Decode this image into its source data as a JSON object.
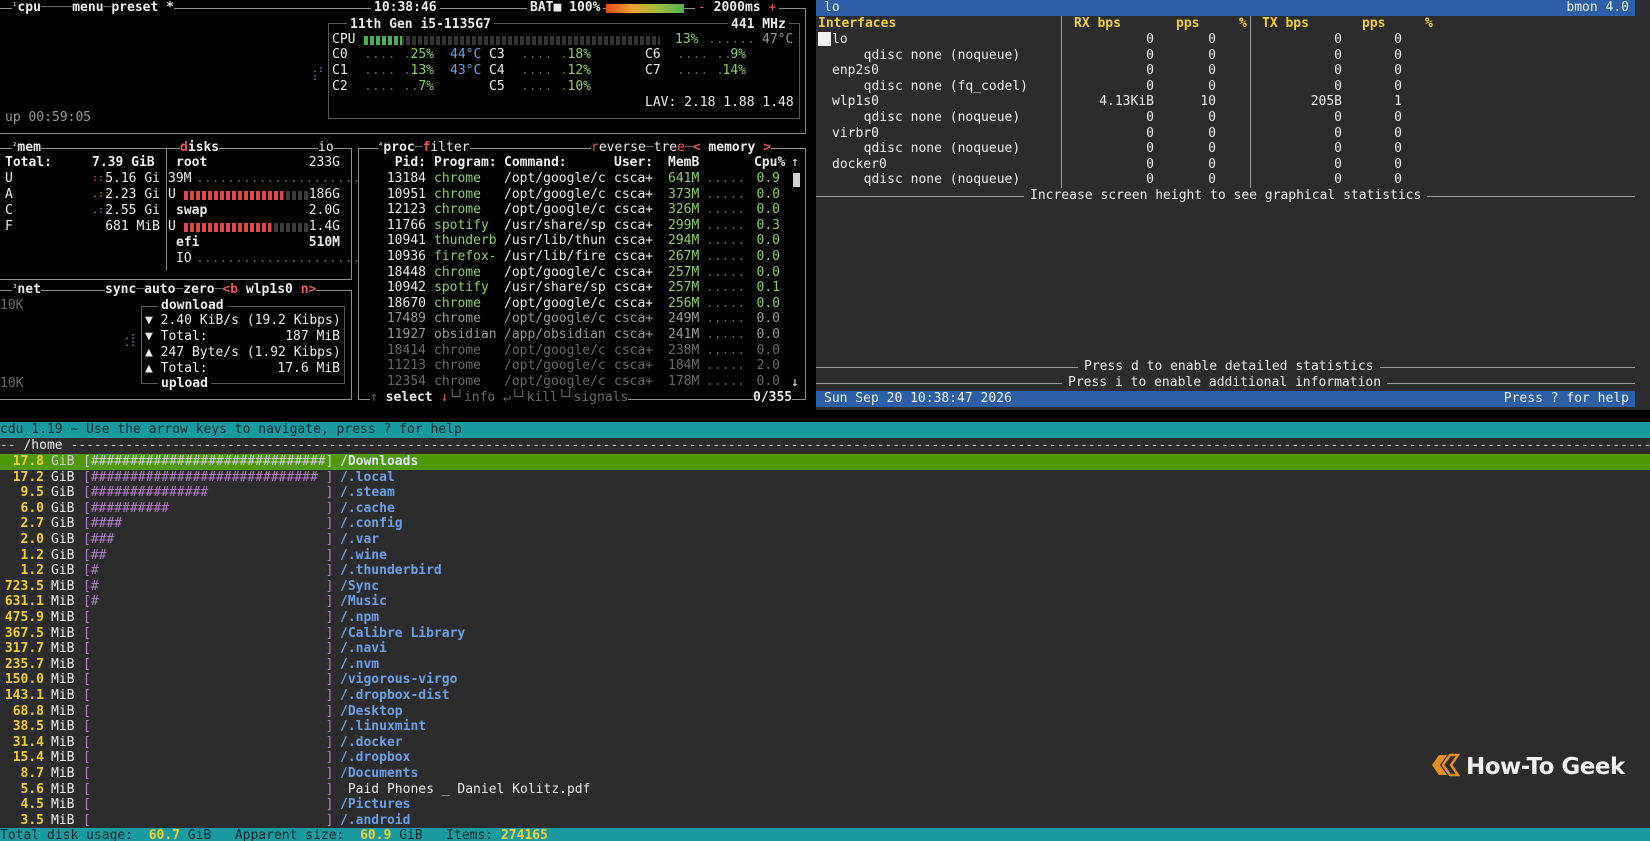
{
  "btop": {
    "cpu_box": {
      "tab_cpu": "cpu",
      "tab_menu": "menu",
      "tab_preset": "preset *",
      "clock": "10:38:46",
      "battery_label": "BAT",
      "battery_pct": "100%",
      "battery_level": 1.0,
      "update_ms": "2000ms",
      "cpu_name": "11th Gen i5-1135G7",
      "cpu_freq": "441 MHz",
      "cpu_total_label": "CPU",
      "cpu_total_pct": "13%",
      "cpu_total_temp": "47°C",
      "cpu_total_level": 0.13,
      "cores": [
        {
          "name": "C0",
          "pct": "25%",
          "temp": "44°C"
        },
        {
          "name": "C1",
          "pct": "13%",
          "temp": "43°C"
        },
        {
          "name": "C2",
          "pct": "7%",
          "temp": ""
        },
        {
          "name": "C3",
          "pct": "18%",
          "temp": ""
        },
        {
          "name": "C4",
          "pct": "12%",
          "temp": ""
        },
        {
          "name": "C5",
          "pct": "10%",
          "temp": ""
        },
        {
          "name": "C6",
          "pct": "9%",
          "temp": ""
        },
        {
          "name": "C7",
          "pct": "14%",
          "temp": ""
        }
      ],
      "load_avg": "LAV: 2.18 1.88 1.48",
      "uptime": "up 00:59:05"
    },
    "mem_box": {
      "title": "mem",
      "total_label": "Total:",
      "total": "7.39 GiB",
      "rows": [
        {
          "label": "U",
          "value": "5.16 Gi"
        },
        {
          "label": "A",
          "value": "2.23 Gi"
        },
        {
          "label": "C",
          "value": "2.55 Gi"
        },
        {
          "label": "F",
          "value": "681 MiB"
        }
      ]
    },
    "disks_box": {
      "title": "disks",
      "io_label": "io",
      "root_label": "root",
      "root_size": "233G",
      "root_io": "39M",
      "root_used_label": "U",
      "root_used": "186G",
      "root_used_level": 0.8,
      "swap_label": "swap",
      "swap_size": "2.0G",
      "swap_used_label": "U",
      "swap_used": "1.4G",
      "swap_used_level": 0.7,
      "efi_label": "efi",
      "efi_size": "510M",
      "efi_io_label": "IO"
    },
    "net_box": {
      "title": "net",
      "sync": "sync",
      "auto": "auto",
      "zero": "zero",
      "b_key": "<b",
      "iface": "wlp1s0",
      "n_key": "n>",
      "scale_top": "10K",
      "scale_bottom": "10K",
      "download_label": "download",
      "dl_rate": "▼ 2.40 KiB/s (19.2 Kibps)",
      "dl_total_label": "▼ Total:",
      "dl_total": "187 MiB",
      "ul_rate": "▲ 247 Byte/s (1.92 Kibps)",
      "ul_total_label": "▲ Total:",
      "ul_total": "17.6 MiB",
      "upload_label": "upload"
    },
    "proc_box": {
      "title": "proc",
      "filter": "filter",
      "reverse": "reverse",
      "tree": "tree",
      "sort_left": "<",
      "sort": "memory",
      "sort_right": ">",
      "headers": {
        "pid": "Pid:",
        "program": "Program:",
        "command": "Command:",
        "user": "User:",
        "mem": "MemB",
        "cpu": "Cpu%"
      },
      "rows": [
        {
          "pid": "13184",
          "program": "chrome",
          "command": "/opt/google/c",
          "user": "csca+",
          "mem": "641M",
          "cpu": "0.9"
        },
        {
          "pid": "10951",
          "program": "chrome",
          "command": "/opt/google/c",
          "user": "csca+",
          "mem": "373M",
          "cpu": "0.0"
        },
        {
          "pid": "12123",
          "program": "chrome",
          "command": "/opt/google/c",
          "user": "csca+",
          "mem": "326M",
          "cpu": "0.0"
        },
        {
          "pid": "11766",
          "program": "spotify",
          "command": "/usr/share/sp",
          "user": "csca+",
          "mem": "299M",
          "cpu": "0.3"
        },
        {
          "pid": "10941",
          "program": "thunderb",
          "command": "/usr/lib/thun",
          "user": "csca+",
          "mem": "294M",
          "cpu": "0.0"
        },
        {
          "pid": "10936",
          "program": "firefox-",
          "command": "/usr/lib/fire",
          "user": "csca+",
          "mem": "267M",
          "cpu": "0.0"
        },
        {
          "pid": "18448",
          "program": "chrome",
          "command": "/opt/google/c",
          "user": "csca+",
          "mem": "257M",
          "cpu": "0.0"
        },
        {
          "pid": "10942",
          "program": "spotify",
          "command": "/usr/share/sp",
          "user": "csca+",
          "mem": "257M",
          "cpu": "0.1"
        },
        {
          "pid": "18670",
          "program": "chrome",
          "command": "/opt/google/c",
          "user": "csca+",
          "mem": "256M",
          "cpu": "0.0"
        },
        {
          "pid": "17489",
          "program": "chrome",
          "command": "/opt/google/c",
          "user": "csca+",
          "mem": "249M",
          "cpu": "0.0"
        },
        {
          "pid": "11927",
          "program": "obsidian",
          "command": "/app/obsidian",
          "user": "csca+",
          "mem": "241M",
          "cpu": "0.0"
        },
        {
          "pid": "18414",
          "program": "chrome",
          "command": "/opt/google/c",
          "user": "csca+",
          "mem": "238M",
          "cpu": "0.0"
        },
        {
          "pid": "11213",
          "program": "chrome",
          "command": "/opt/google/c",
          "user": "csca+",
          "mem": "184M",
          "cpu": "2.0"
        },
        {
          "pid": "12354",
          "program": "chrome",
          "command": "/opt/google/c",
          "user": "csca+",
          "mem": "178M",
          "cpu": "0.0"
        }
      ],
      "footer_select": "select",
      "footer_info": "info",
      "footer_kill": "kill",
      "footer_signals": "signals",
      "count": "0/355"
    }
  },
  "bmon": {
    "title_left": "lo",
    "title_right": "bmon 4.0",
    "headers": {
      "iface": "Interfaces",
      "rx_bps": "RX bps",
      "rx_pps": "pps",
      "rx_pct": "%",
      "tx_bps": "TX bps",
      "tx_pps": "pps",
      "tx_pct": "%"
    },
    "rows": [
      {
        "name": "lo",
        "rx_bps": "0",
        "rx_pps": "0",
        "tx_bps": "0",
        "tx_pps": "0"
      },
      {
        "name": "  qdisc none (noqueue)",
        "rx_bps": "0",
        "rx_pps": "0",
        "tx_bps": "0",
        "tx_pps": "0"
      },
      {
        "name": "enp2s0",
        "rx_bps": "0",
        "rx_pps": "0",
        "tx_bps": "0",
        "tx_pps": "0"
      },
      {
        "name": "  qdisc none (fq_codel)",
        "rx_bps": "0",
        "rx_pps": "0",
        "tx_bps": "0",
        "tx_pps": "0"
      },
      {
        "name": "wlp1s0",
        "rx_bps": "4.13KiB",
        "rx_pps": "10",
        "tx_bps": "205B",
        "tx_pps": "1"
      },
      {
        "name": "  qdisc none (noqueue)",
        "rx_bps": "0",
        "rx_pps": "0",
        "tx_bps": "0",
        "tx_pps": "0"
      },
      {
        "name": "virbr0",
        "rx_bps": "0",
        "rx_pps": "0",
        "tx_bps": "0",
        "tx_pps": "0"
      },
      {
        "name": "  qdisc none (noqueue)",
        "rx_bps": "0",
        "rx_pps": "0",
        "tx_bps": "0",
        "tx_pps": "0"
      },
      {
        "name": "docker0",
        "rx_bps": "0",
        "rx_pps": "0",
        "tx_bps": "0",
        "tx_pps": "0"
      },
      {
        "name": "  qdisc none (noqueue)",
        "rx_bps": "0",
        "rx_pps": "0",
        "tx_bps": "0",
        "tx_pps": "0"
      }
    ],
    "graph_msg": "Increase screen height to see graphical statistics",
    "detail_msg": "Press d to enable detailed statistics",
    "info_msg": "Press i to enable additional information",
    "status_time": "Sun Sep 20 10:38:47 2026",
    "status_help": "Press ? for help"
  },
  "ncdu": {
    "header": "cdu 1.19 ~ Use the arrow keys to navigate, press ? for help",
    "path": "/home",
    "rows": [
      {
        "size": "17.8",
        "unit": "GiB",
        "bar": "[##############################]",
        "name": "/Downloads"
      },
      {
        "size": "17.2",
        "unit": "GiB",
        "bar": "[############################# ]",
        "name": "/.local"
      },
      {
        "size": "9.5",
        "unit": "GiB",
        "bar": "[###############               ]",
        "name": "/.steam"
      },
      {
        "size": "6.0",
        "unit": "GiB",
        "bar": "[##########                    ]",
        "name": "/.cache"
      },
      {
        "size": "2.7",
        "unit": "GiB",
        "bar": "[####                          ]",
        "name": "/.config"
      },
      {
        "size": "2.0",
        "unit": "GiB",
        "bar": "[###                           ]",
        "name": "/.var"
      },
      {
        "size": "1.2",
        "unit": "GiB",
        "bar": "[##                            ]",
        "name": "/.wine"
      },
      {
        "size": "1.2",
        "unit": "GiB",
        "bar": "[#                             ]",
        "name": "/.thunderbird"
      },
      {
        "size": "723.5",
        "unit": "MiB",
        "bar": "[#                             ]",
        "name": "/Sync"
      },
      {
        "size": "631.1",
        "unit": "MiB",
        "bar": "[#                             ]",
        "name": "/Music"
      },
      {
        "size": "475.9",
        "unit": "MiB",
        "bar": "[                              ]",
        "name": "/.npm"
      },
      {
        "size": "367.5",
        "unit": "MiB",
        "bar": "[                              ]",
        "name": "/Calibre Library"
      },
      {
        "size": "317.7",
        "unit": "MiB",
        "bar": "[                              ]",
        "name": "/.navi"
      },
      {
        "size": "235.7",
        "unit": "MiB",
        "bar": "[                              ]",
        "name": "/.nvm"
      },
      {
        "size": "150.0",
        "unit": "MiB",
        "bar": "[                              ]",
        "name": "/vigorous-virgo"
      },
      {
        "size": "143.1",
        "unit": "MiB",
        "bar": "[                              ]",
        "name": "/.dropbox-dist"
      },
      {
        "size": "68.8",
        "unit": "MiB",
        "bar": "[                              ]",
        "name": "/Desktop"
      },
      {
        "size": "38.5",
        "unit": "MiB",
        "bar": "[                              ]",
        "name": "/.linuxmint"
      },
      {
        "size": "31.4",
        "unit": "MiB",
        "bar": "[                              ]",
        "name": "/.docker"
      },
      {
        "size": "15.4",
        "unit": "MiB",
        "bar": "[                              ]",
        "name": "/.dropbox"
      },
      {
        "size": "8.7",
        "unit": "MiB",
        "bar": "[                              ]",
        "name": "/Documents"
      },
      {
        "size": "5.6",
        "unit": "MiB",
        "bar": "[                              ]",
        "name": " Paid Phones _ Daniel Kolitz.pdf",
        "is_file": true
      },
      {
        "size": "4.5",
        "unit": "MiB",
        "bar": "[                              ]",
        "name": "/Pictures"
      },
      {
        "size": "3.5",
        "unit": "MiB",
        "bar": "[                              ]",
        "name": "/.android"
      }
    ],
    "footer_total_label": "Total disk usage:",
    "footer_total": "60.7",
    "footer_total_unit": "GiB",
    "footer_apparent_label": "Apparent size:",
    "footer_apparent": "60.9",
    "footer_apparent_unit": "GiB",
    "footer_items_label": "Items:",
    "footer_items": "274165"
  },
  "logo": {
    "text": "How-To Geek"
  },
  "colors": {
    "bmon_blue": "#2d5fa8",
    "ncdu_cyan": "#1a9ba2",
    "ncdu_selected": "#4e9a06",
    "btop_green": "#8ed068",
    "btop_red": "#e85a5a"
  }
}
